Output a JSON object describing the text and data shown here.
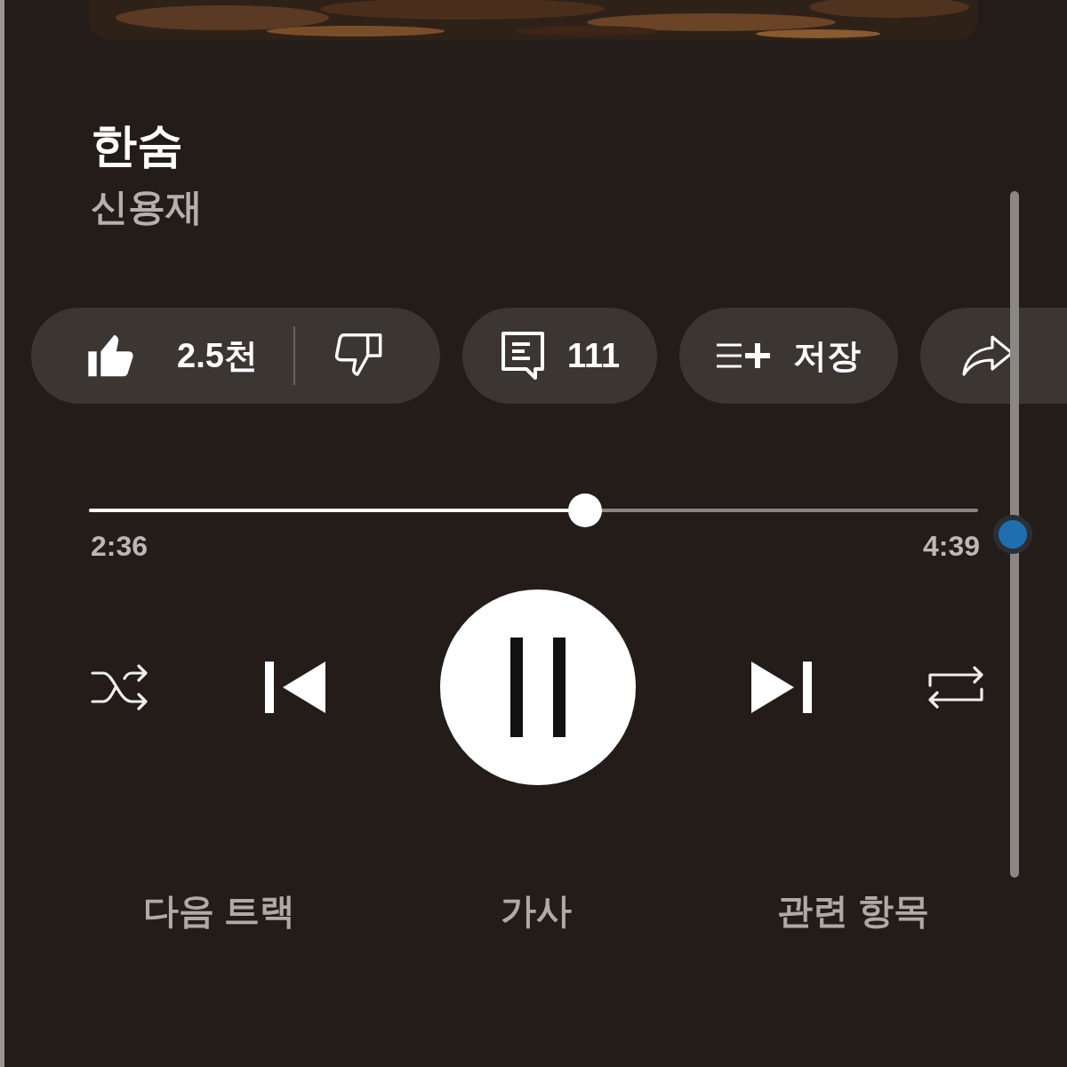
{
  "track": {
    "title": "한숨",
    "artist": "신용재"
  },
  "actions": [
    {
      "kind": "like",
      "label": "2.5천",
      "liked": true,
      "disliked": false
    },
    {
      "kind": "comments",
      "label": "111"
    },
    {
      "kind": "save",
      "label": "저장"
    },
    {
      "kind": "share"
    }
  ],
  "progress": {
    "level": 0.558,
    "elapsed": "2:36",
    "duration": "4:39"
  },
  "controls": {
    "shuffle": false,
    "repeat": false,
    "playing": true
  },
  "tabs": [
    {
      "label": "다음 트랙",
      "selected": false
    },
    {
      "label": "가사",
      "selected": false
    },
    {
      "label": "관련 항목",
      "selected": false
    }
  ]
}
